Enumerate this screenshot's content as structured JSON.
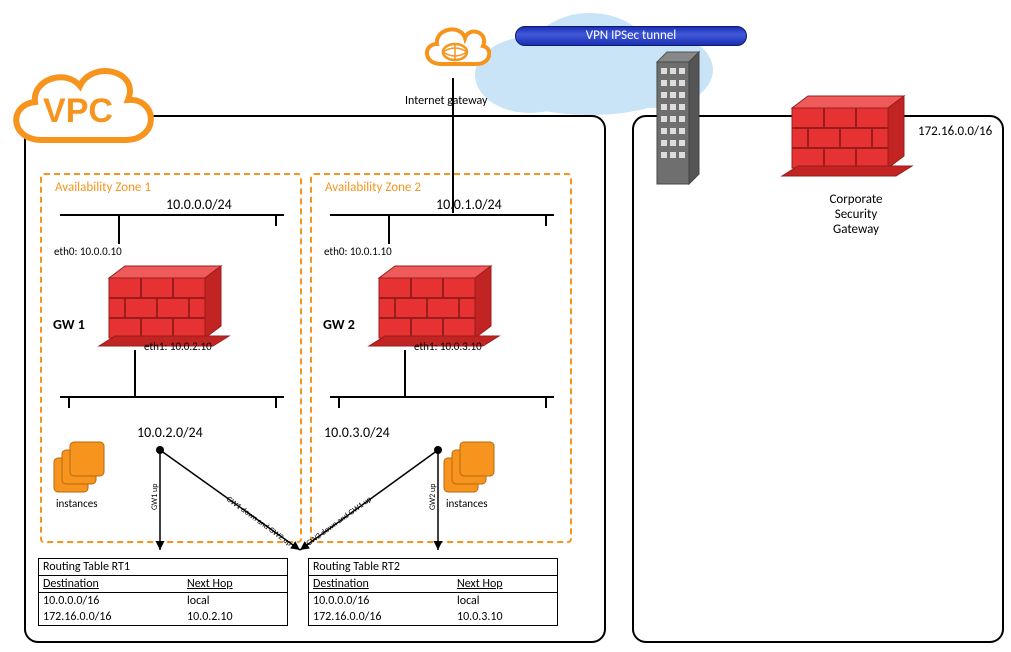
{
  "vpc_badge": "VPC",
  "internet_gateway_label": "Internet gateway",
  "tunnel_label": "VPN IPSec tunnel",
  "corp": {
    "label_line1": "Corporate",
    "label_line2": "Security",
    "label_line3": "Gateway",
    "cidr": "172.16.0.0/16"
  },
  "az1": {
    "title": "Availability Zone 1",
    "public_cidr": "10.0.0.0/24",
    "private_cidr": "10.0.2.0/24",
    "eth0": "eth0: 10.0.0.10",
    "eth1": "eth1: 10.0.2.10",
    "gw": "GW 1",
    "instances": "instances"
  },
  "az2": {
    "title": "Availability Zone 2",
    "public_cidr": "10.0.1.0/24",
    "private_cidr": "10.0.3.0/24",
    "eth0": "eth0: 10.0.1.10",
    "eth1": "eth1: 10.0.3.10",
    "gw": "GW 2",
    "instances": "instances"
  },
  "failover": {
    "gw1_up": "GW1 up",
    "gw1_down": "GW1 down and GW2 up",
    "gw2_down": "GW2 down and GW1 up",
    "gw2_up": "GW2 up"
  },
  "rt1": {
    "title": "Routing Table RT1",
    "h_dest": "Destination",
    "h_hop": "Next Hop",
    "r1_dest": "10.0.0.0/16",
    "r1_hop": "local",
    "r2_dest": "172.16.0.0/16",
    "r2_hop": "10.0.2.10"
  },
  "rt2": {
    "title": "Routing Table RT2",
    "h_dest": "Destination",
    "h_hop": "Next Hop",
    "r1_dest": "10.0.0.0/16",
    "r1_hop": "local",
    "r2_dest": "172.16.0.0/16",
    "r2_hop": "10.0.3.10"
  }
}
